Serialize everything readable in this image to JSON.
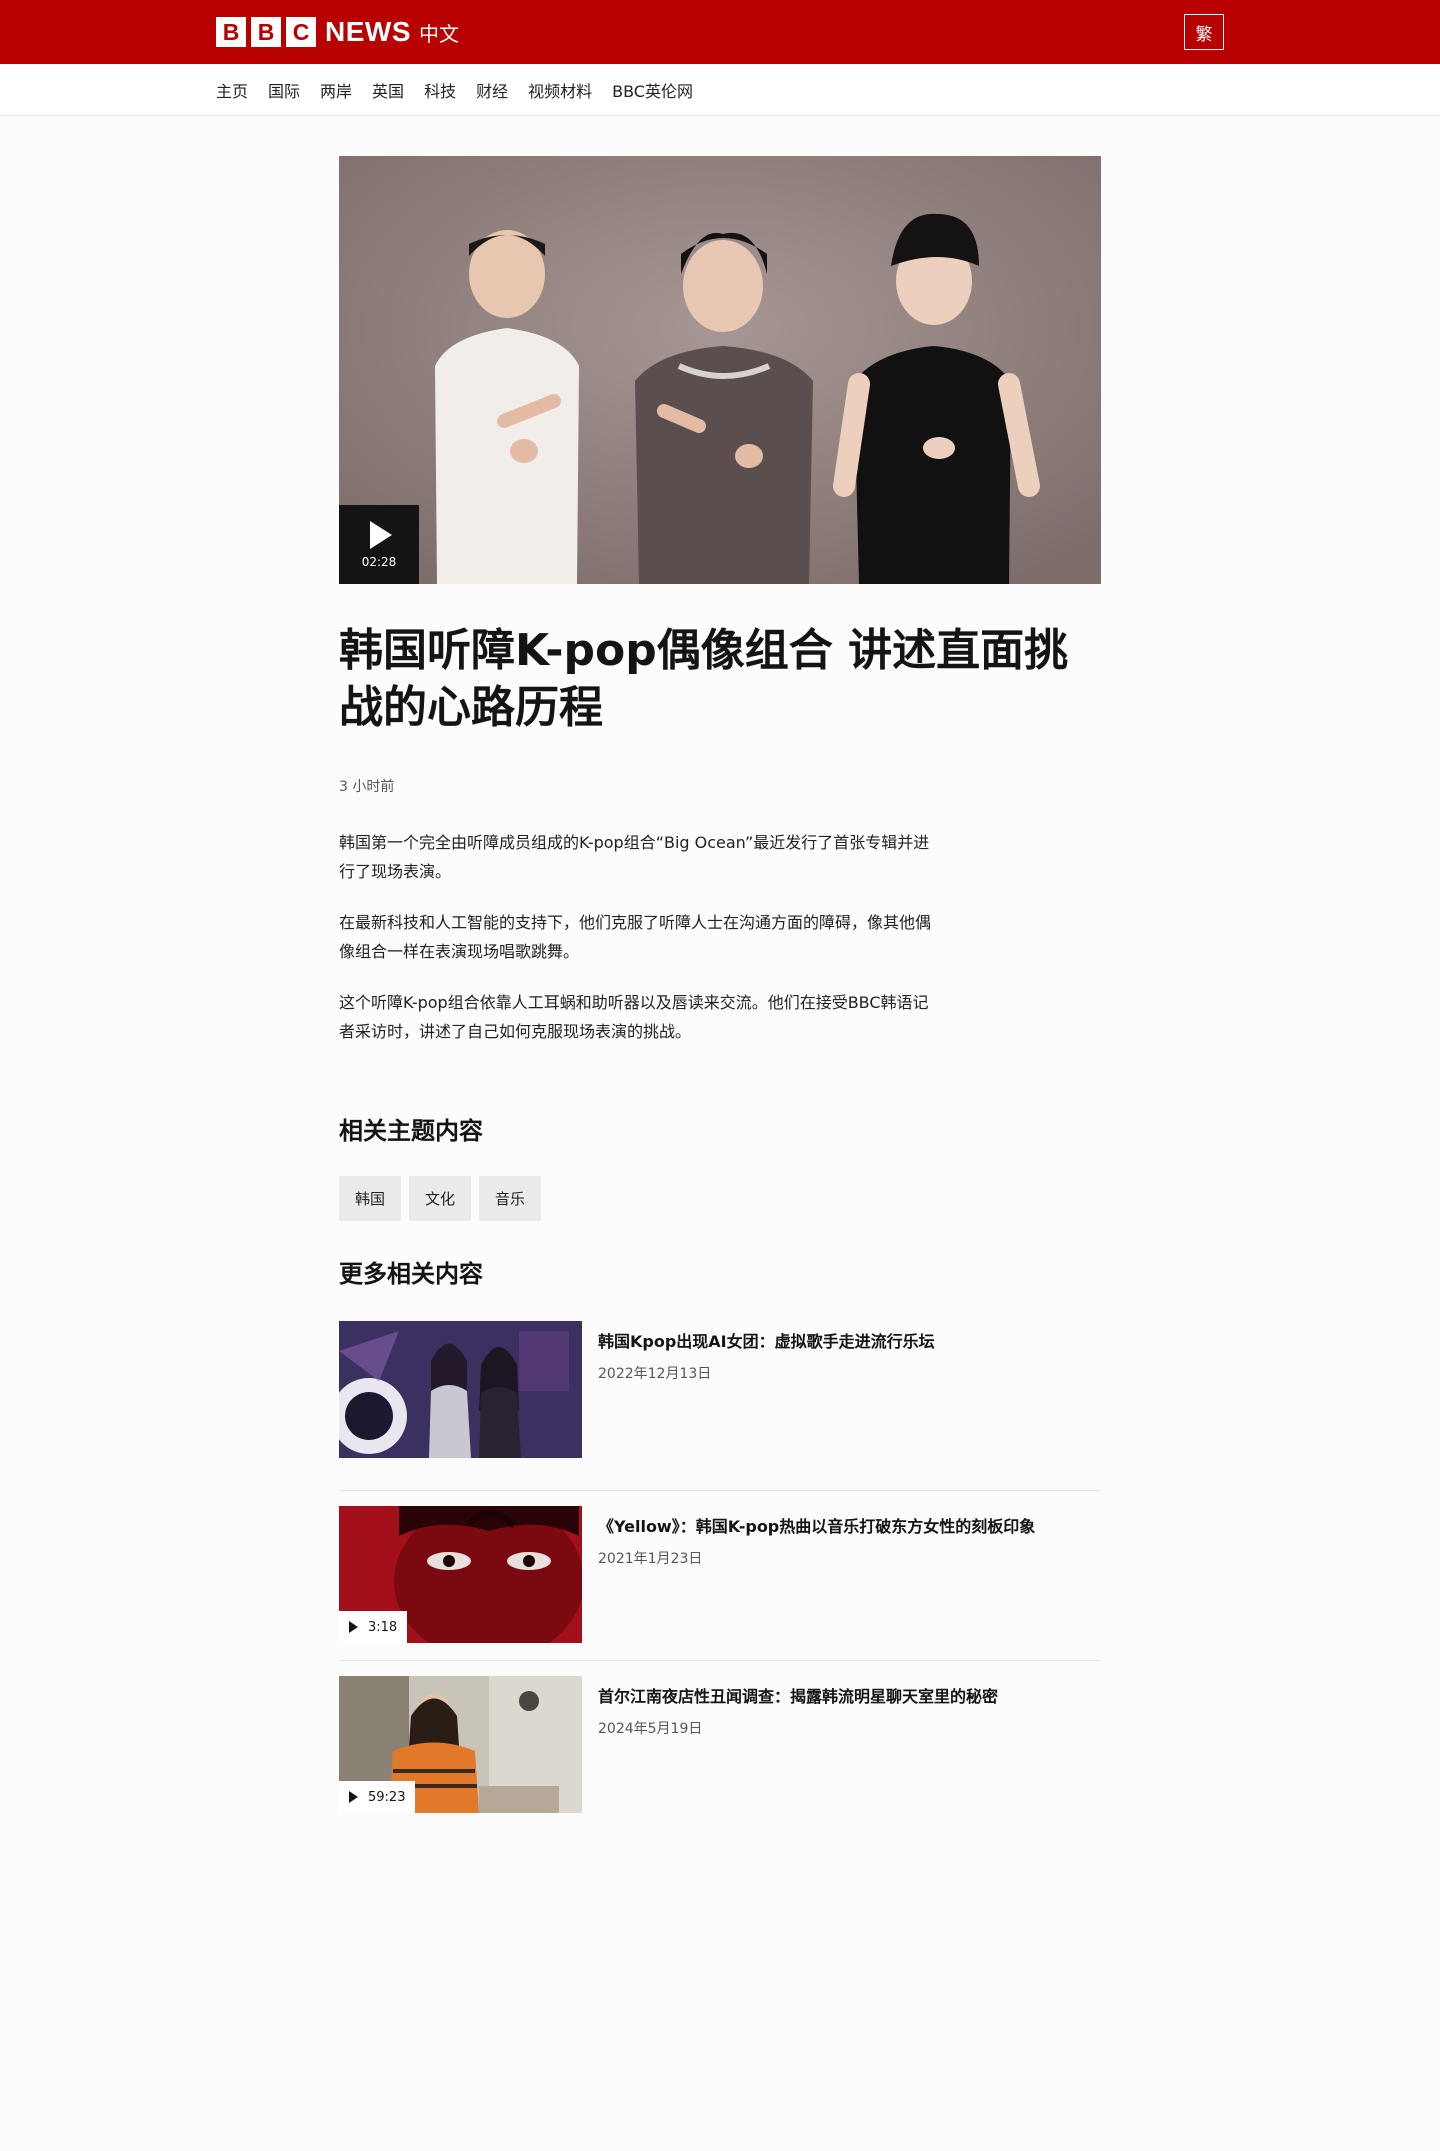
{
  "header": {
    "brand_letters": [
      "B",
      "B",
      "C"
    ],
    "brand_news": "NEWS",
    "brand_lang": "中文",
    "traditional_toggle": "繁"
  },
  "nav": {
    "items": [
      "主页",
      "国际",
      "两岸",
      "英国",
      "科技",
      "财经",
      "视频材料",
      "BBC英伦网"
    ]
  },
  "article": {
    "video_duration": "02:28",
    "headline": "韩国听障K-pop偶像组合 讲述直面挑战的心路历程",
    "timestamp": "3 小时前",
    "paragraphs": [
      "韩国第一个完全由听障成员组成的K-pop组合“Big Ocean”最近发行了首张专辑并进行了现场表演。",
      "在最新科技和人工智能的支持下，他们克服了听障人士在沟通方面的障碍，像其他偶像组合一样在表演现场唱歌跳舞。",
      "这个听障K-pop组合依靠人工耳蜗和助听器以及唇读来交流。他们在接受BBC韩语记者采访时，讲述了自己如何克服现场表演的挑战。"
    ]
  },
  "topics": {
    "title": "相关主题内容",
    "tags": [
      "韩国",
      "文化",
      "音乐"
    ]
  },
  "more": {
    "title": "更多相关内容",
    "items": [
      {
        "title": "韩国Kpop出现AI女团：虚拟歌手走进流行乐坛",
        "date": "2022年12月13日",
        "duration": ""
      },
      {
        "title": "《Yellow》：韩国K-pop热曲以音乐打破东方女性的刻板印象",
        "date": "2021年1月23日",
        "duration": "3:18"
      },
      {
        "title": "首尔江南夜店性丑闻调查：揭露韩流明星聊天室里的秘密",
        "date": "2024年5月19日",
        "duration": "59:23"
      }
    ]
  },
  "colors": {
    "brand_red": "#b80000",
    "text": "#141414",
    "muted": "#545658",
    "tag_bg": "#ebebeb"
  }
}
